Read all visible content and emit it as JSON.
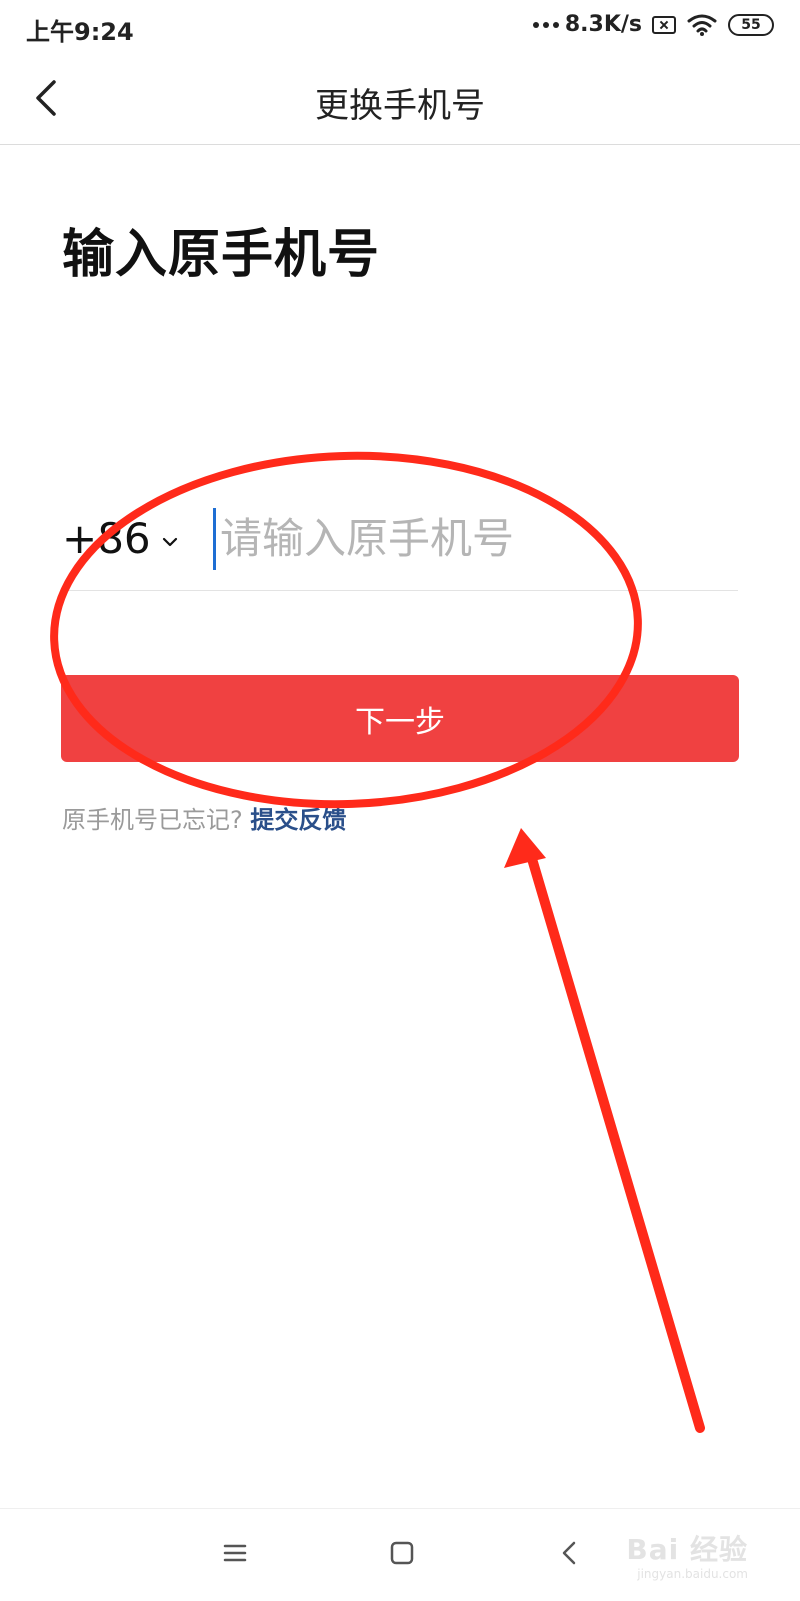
{
  "status_bar": {
    "time": "上午9:24",
    "network_speed": "8.3K/s",
    "battery": "55"
  },
  "header": {
    "title": "更换手机号"
  },
  "main": {
    "heading": "输入原手机号",
    "country_code": "+86",
    "phone_placeholder": "请输入原手机号",
    "phone_value": "",
    "next_button_label": "下一步",
    "forgot_prompt": "原手机号已忘记?",
    "feedback_link": "提交反馈"
  },
  "watermark": {
    "brand": "Bai 经验",
    "site": "jingyan.baidu.com"
  },
  "colors": {
    "accent": "#f04141",
    "caret": "#1e6ed3",
    "link": "#2a4f8a",
    "annotation": "#ff2a1a"
  },
  "icons": {
    "back": "chevron-left-icon",
    "country_dropdown": "chevron-down-icon",
    "nav_menu": "menu-icon",
    "nav_home": "home-icon",
    "nav_back": "back-icon"
  }
}
